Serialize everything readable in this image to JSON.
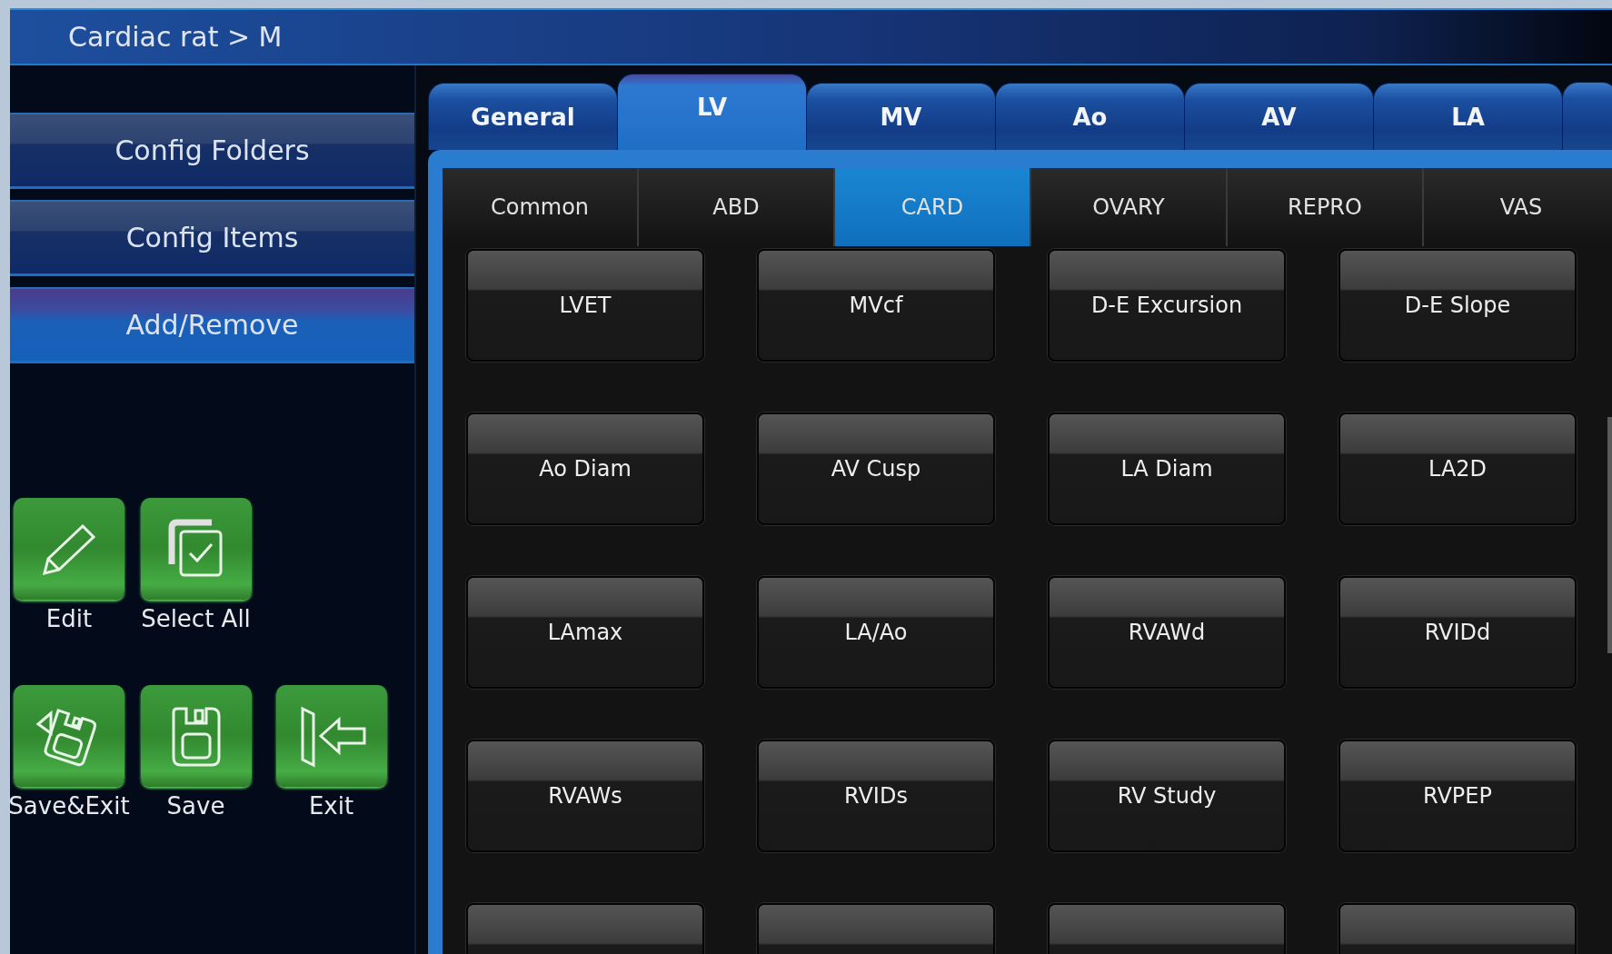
{
  "header": {
    "breadcrumb": "Cardiac rat > M"
  },
  "sidebar": {
    "items": [
      {
        "label": "Config Folders",
        "selected": false
      },
      {
        "label": "Config Items",
        "selected": false
      },
      {
        "label": "Add/Remove",
        "selected": true
      }
    ]
  },
  "actions": [
    [
      {
        "kind": "edit",
        "label": "Edit"
      },
      {
        "kind": "select_all",
        "label": "Select All"
      }
    ],
    [
      {
        "kind": "save_exit",
        "label": "Save&Exit"
      },
      {
        "kind": "save",
        "label": "Save"
      },
      {
        "kind": "exit",
        "label": "Exit"
      }
    ]
  ],
  "tabs": [
    {
      "label": "General",
      "selected": false
    },
    {
      "label": "LV",
      "selected": true
    },
    {
      "label": "MV",
      "selected": false
    },
    {
      "label": "Ao",
      "selected": false
    },
    {
      "label": "AV",
      "selected": false
    },
    {
      "label": "LA",
      "selected": false
    }
  ],
  "subtabs": [
    {
      "label": "Common",
      "selected": false
    },
    {
      "label": "ABD",
      "selected": false
    },
    {
      "label": "CARD",
      "selected": true
    },
    {
      "label": "OVARY",
      "selected": false
    },
    {
      "label": "REPRO",
      "selected": false
    },
    {
      "label": "VAS",
      "selected": false
    }
  ],
  "measurements": [
    "LVET",
    "MVcf",
    "D-E Excursion",
    "D-E Slope",
    "Ao Diam",
    "AV Cusp",
    "LA Diam",
    "LA2D",
    "LAmax",
    "LA/Ao",
    "RVAWd",
    "RVIDd",
    "RVAWs",
    "RVIDs",
    "RV Study",
    "RVPEP"
  ]
}
